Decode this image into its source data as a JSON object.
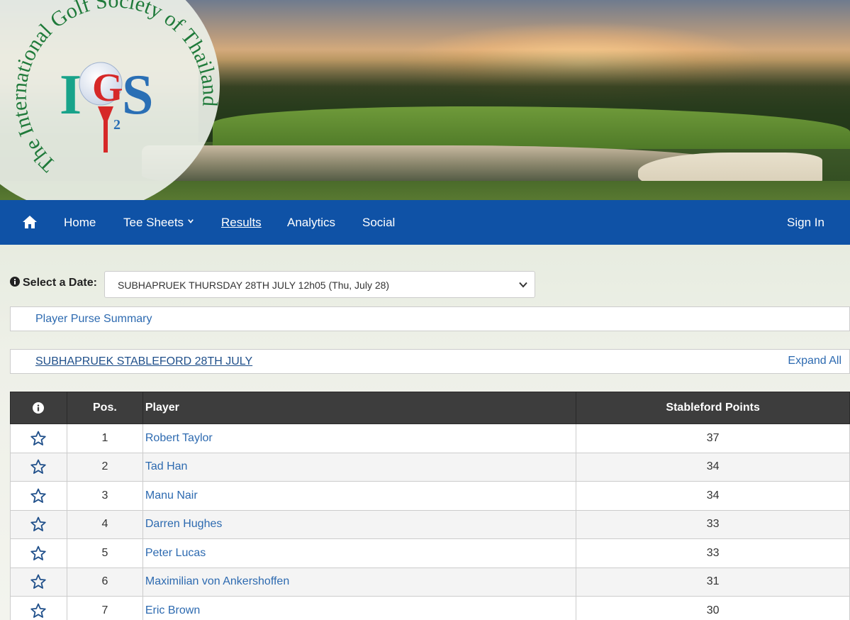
{
  "banner": {
    "logo_letters": "IGS",
    "logo_superscript": "2",
    "logo_ring_text": "The International Golf Society of Thailand"
  },
  "nav": {
    "home": "Home",
    "tee_sheets": "Tee Sheets",
    "results": "Results",
    "analytics": "Analytics",
    "social": "Social",
    "sign_in": "Sign In"
  },
  "date_select": {
    "label": "Select a Date:",
    "value": "SUBHAPRUEK THURSDAY 28TH JULY 12h05 (Thu, July 28)"
  },
  "panels": {
    "purse_summary": "Player Purse Summary",
    "competition": "SUBHAPRUEK STABLEFORD 28TH JULY",
    "expand_all": "Expand All"
  },
  "table": {
    "headers": {
      "pos": "Pos.",
      "player": "Player",
      "points": "Stableford Points"
    },
    "rows": [
      {
        "pos": "1",
        "player": "Robert Taylor",
        "points": "37"
      },
      {
        "pos": "2",
        "player": "Tad Han",
        "points": "34"
      },
      {
        "pos": "3",
        "player": "Manu Nair",
        "points": "34"
      },
      {
        "pos": "4",
        "player": "Darren Hughes",
        "points": "33"
      },
      {
        "pos": "5",
        "player": "Peter Lucas",
        "points": "33"
      },
      {
        "pos": "6",
        "player": "Maximilian von Ankershoffen",
        "points": "31"
      },
      {
        "pos": "7",
        "player": "Eric Brown",
        "points": "30"
      }
    ]
  },
  "colors": {
    "nav": "#0f52a6",
    "link": "#2d6ab0",
    "table_header": "#3d3d3d",
    "logo_green": "#1f7a3a",
    "logo_blue": "#2a6fb5",
    "logo_red": "#d62828"
  }
}
